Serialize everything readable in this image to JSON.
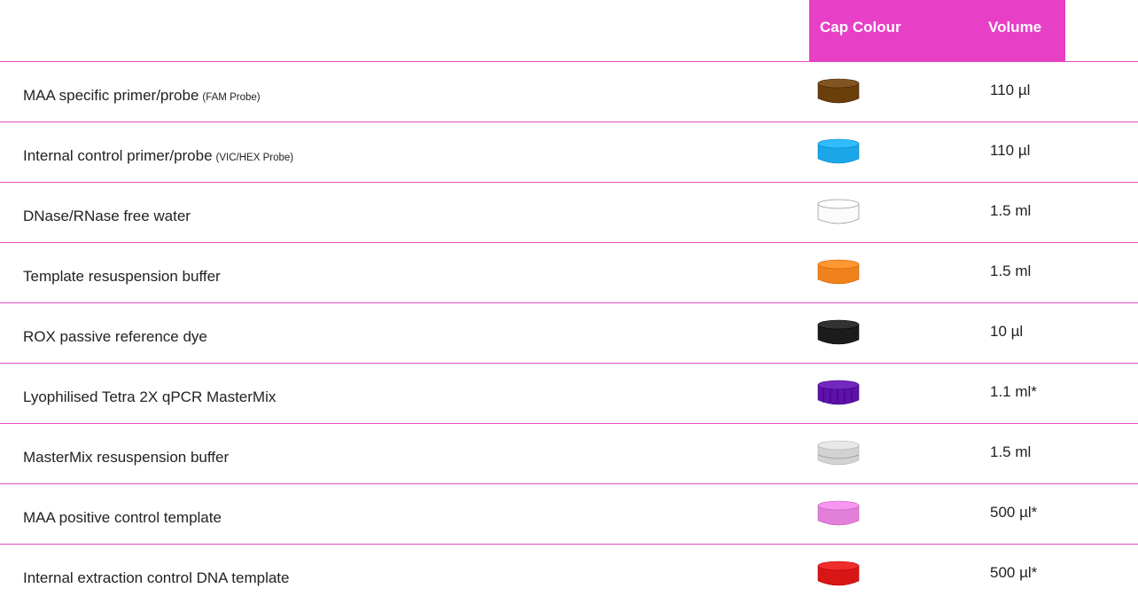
{
  "header": {
    "cap_colour": "Cap Colour",
    "volume": "Volume",
    "background": "#e73fc6"
  },
  "rows": [
    {
      "name": "MAA specific primer/probe",
      "note": "(FAM Probe)",
      "cap_color": "#6b3f0c",
      "cap_icon": "brown-cap-icon",
      "volume": "110 µl"
    },
    {
      "name": "Internal control primer/probe",
      "note": "(VIC/HEX Probe)",
      "cap_color": "#1ba6e8",
      "cap_icon": "blue-cap-icon",
      "volume": "110 µl"
    },
    {
      "name": "DNase/RNase free water",
      "note": "",
      "cap_color": "#fbfbfb",
      "cap_icon": "white-cap-icon",
      "volume": "1.5 ml"
    },
    {
      "name": "Template resuspension buffer",
      "note": "",
      "cap_color": "#f0821c",
      "cap_icon": "orange-cap-icon",
      "volume": "1.5 ml"
    },
    {
      "name": "ROX passive reference dye",
      "note": "",
      "cap_color": "#1c1c1c",
      "cap_icon": "black-cap-icon",
      "volume": "10 µl"
    },
    {
      "name": "Lyophilised Tetra 2X qPCR MasterMix",
      "note": "",
      "cap_color": "#5e12a8",
      "cap_icon": "purple-cap-icon",
      "volume": "1.1 ml*"
    },
    {
      "name": "MasterMix resuspension buffer",
      "note": "",
      "cap_color": "#d2d2d2",
      "cap_icon": "clear-cap-icon",
      "volume": "1.5 ml"
    },
    {
      "name": "MAA positive control template",
      "note": "",
      "cap_color": "#e27fd8",
      "cap_icon": "pink-cap-icon",
      "volume": "500 µl*"
    },
    {
      "name": "Internal extraction control DNA template",
      "note": "",
      "cap_color": "#d81616",
      "cap_icon": "red-cap-icon",
      "volume": "500 µl*"
    }
  ]
}
